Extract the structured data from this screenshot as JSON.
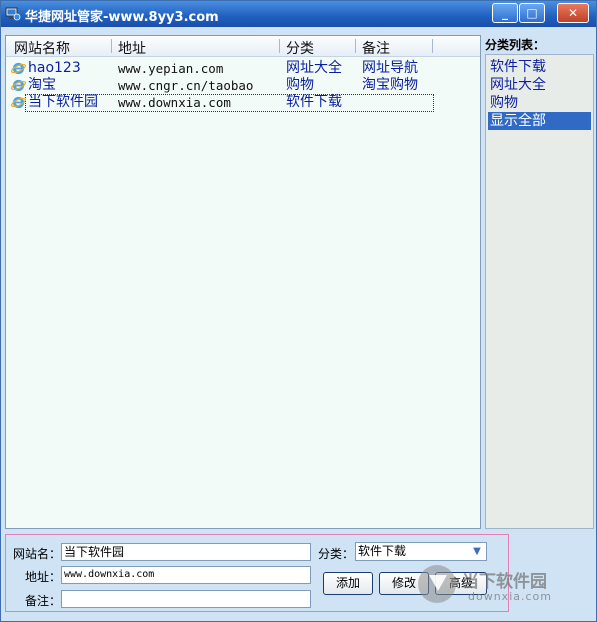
{
  "window": {
    "title": "华捷网址管家-www.8yy3.com",
    "buttons": {
      "minimize": "_",
      "maximize": "□",
      "close": "✕"
    }
  },
  "list": {
    "columns": [
      "网站名称",
      "地址",
      "分类",
      "备注"
    ],
    "rows": [
      {
        "name": "hao123",
        "url": "www.yepian.com",
        "category": "网址大全",
        "note": "网址导航"
      },
      {
        "name": "淘宝",
        "url": "www.cngr.cn/taobao",
        "category": "购物",
        "note": "淘宝购物"
      },
      {
        "name": "当下软件园",
        "url": "www.downxia.com",
        "category": "软件下载",
        "note": ""
      }
    ]
  },
  "sidebar": {
    "title": "分类列表：",
    "items": [
      "软件下载",
      "网址大全",
      "购物",
      "显示全部"
    ]
  },
  "form": {
    "name_label": "网站名：",
    "name_value": "当下软件园",
    "url_label": "地址：",
    "url_value": "www.downxia.com",
    "note_label": "备注：",
    "note_value": "",
    "category_label": "分类：",
    "category_value": "软件下载",
    "add_label": "添加",
    "edit_label": "修改",
    "advanced_label": "高级"
  },
  "watermark": {
    "text": "当下软件园",
    "sub": "downxia.com"
  },
  "colors": {
    "titlebar": "#1f5fbf",
    "selection": "#316ac5",
    "link_text": "#0a1fa0"
  }
}
